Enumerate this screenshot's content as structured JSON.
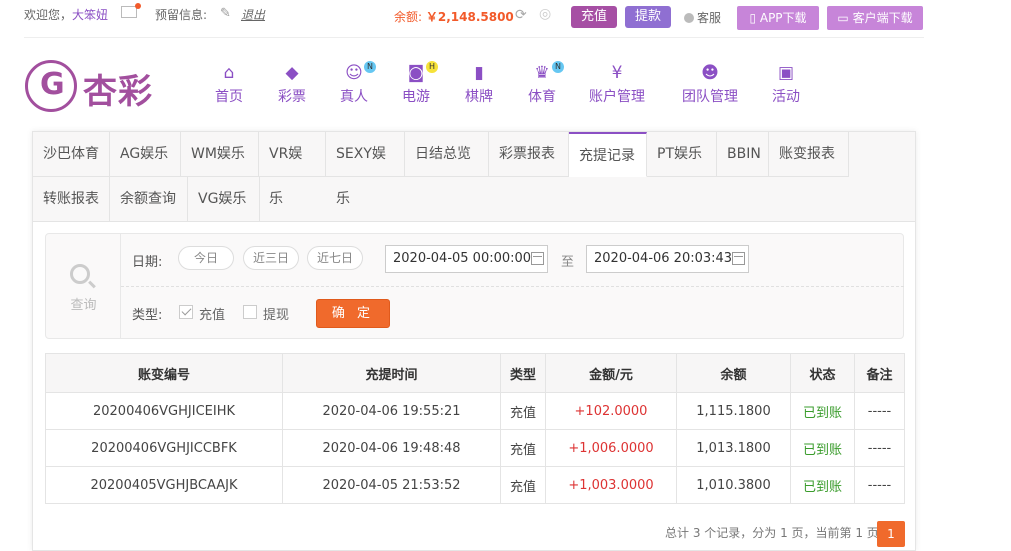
{
  "topbar": {
    "welcome": "欢迎您，",
    "username": "大笨妞",
    "msg_label": "预留信息:",
    "logout": "退出",
    "balance_label": "余额: ",
    "balance_value": "￥2,148.5800",
    "recharge": "充值",
    "withdraw": "提款",
    "service": "客服",
    "app_download": "APP下载",
    "client_download": "客户端下载"
  },
  "logo": {
    "text": "杏彩"
  },
  "nav": [
    {
      "label": "首页",
      "icon": "home-icon",
      "glyph": "⌂"
    },
    {
      "label": "彩票",
      "icon": "lottery-icon",
      "glyph": "◆"
    },
    {
      "label": "真人",
      "icon": "live-icon",
      "glyph": "☺",
      "badge": "N"
    },
    {
      "label": "电游",
      "icon": "gamepad-icon",
      "glyph": "◙",
      "badge": "H"
    },
    {
      "label": "棋牌",
      "icon": "cards-icon",
      "glyph": "▮"
    },
    {
      "label": "体育",
      "icon": "trophy-icon",
      "glyph": "♛",
      "badge": "N"
    },
    {
      "label": "账户管理",
      "icon": "account-icon",
      "glyph": "¥"
    },
    {
      "label": "团队管理",
      "icon": "team-icon",
      "glyph": "☻"
    },
    {
      "label": "活动",
      "icon": "gift-icon",
      "glyph": "▣"
    }
  ],
  "tabs": [
    "沙巴体育",
    "AG娱乐",
    "WM娱乐",
    "VR娱乐",
    "SEXY娱乐",
    "日结总览",
    "彩票报表",
    "充提记录",
    "PT娱乐",
    "BBIN",
    "账变报表",
    "转账报表",
    "余额查询",
    "VG娱乐"
  ],
  "active_tab": "充提记录",
  "query": {
    "search_label": "查询",
    "date_label": "日期:",
    "quick": [
      "今日",
      "近三日",
      "近七日"
    ],
    "start": "2020-04-05 00:00:00",
    "to": "至",
    "end": "2020-04-06 20:03:43",
    "type_label": "类型:",
    "type_recharge": "充值",
    "type_withdraw": "提现",
    "recharge_checked": true,
    "withdraw_checked": false,
    "confirm": "确 定"
  },
  "table": {
    "headers": [
      "账变编号",
      "充提时间",
      "类型",
      "金额/元",
      "余额",
      "状态",
      "备注"
    ],
    "rows": [
      [
        "20200406VGHJICEIHK",
        "2020-04-06 19:55:21",
        "充值",
        "+102.0000",
        "1,115.1800",
        "已到账",
        "-----"
      ],
      [
        "20200406VGHJICCBFK",
        "2020-04-06 19:48:48",
        "充值",
        "+1,006.0000",
        "1,013.1800",
        "已到账",
        "-----"
      ],
      [
        "20200405VGHJBCAAJK",
        "2020-04-05 21:53:52",
        "充值",
        "+1,003.0000",
        "1,010.3800",
        "已到账",
        "-----"
      ]
    ]
  },
  "pager": {
    "summary": "总计 3 个记录，分为 1 页，当前第 1 页",
    "current": "1"
  },
  "colors": {
    "brand": "#8b4fc4",
    "accent": "#f06a2c",
    "amount": "#dd3333",
    "status_ok": "#3a9c2c"
  }
}
